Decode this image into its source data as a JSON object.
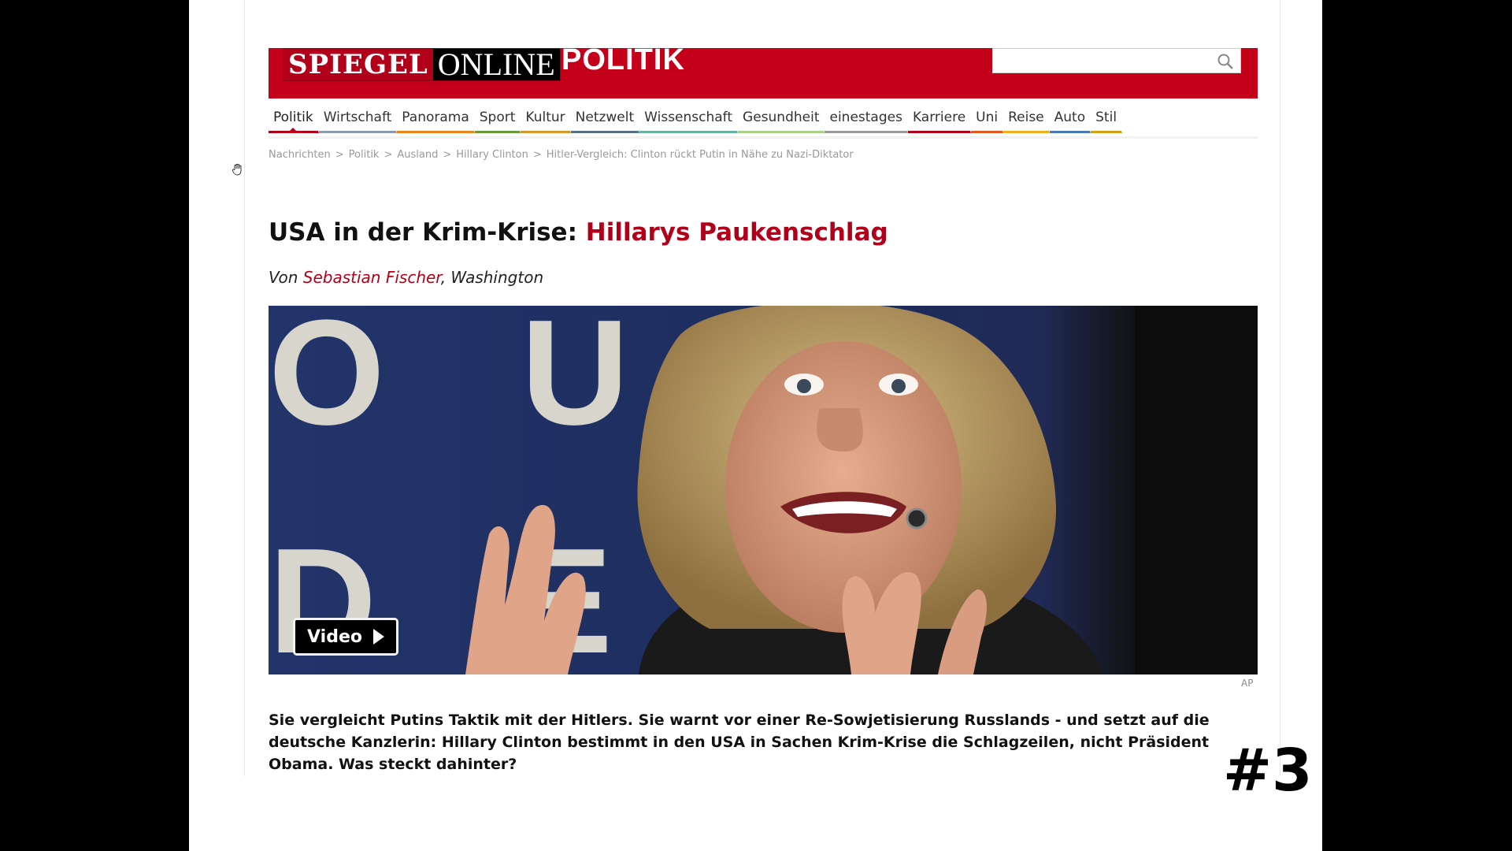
{
  "header": {
    "logo_spiegel": "SPIEGEL",
    "logo_online": "ONLINE",
    "section": "POLITIK",
    "search_placeholder": ""
  },
  "nav": [
    {
      "label": "Politik",
      "color": "#b3001a",
      "active": true
    },
    {
      "label": "Wirtschaft",
      "color": "#8a9bb0"
    },
    {
      "label": "Panorama",
      "color": "#e8851c"
    },
    {
      "label": "Sport",
      "color": "#6a9a3a"
    },
    {
      "label": "Kultur",
      "color": "#d79a2a"
    },
    {
      "label": "Netzwelt",
      "color": "#5a6f8a"
    },
    {
      "label": "Wissenschaft",
      "color": "#6bb2a0"
    },
    {
      "label": "Gesundheit",
      "color": "#a8d08a"
    },
    {
      "label": "einestages",
      "color": "#9a9a9a"
    },
    {
      "label": "Karriere",
      "color": "#b3001a"
    },
    {
      "label": "Uni",
      "color": "#e05a20"
    },
    {
      "label": "Reise",
      "color": "#f0b020"
    },
    {
      "label": "Auto",
      "color": "#4a7ab5"
    },
    {
      "label": "Stil",
      "color": "#d4a017"
    }
  ],
  "breadcrumb": [
    "Nachrichten",
    ">",
    "Politik",
    ">",
    "Ausland",
    ">",
    "Hillary Clinton",
    ">",
    "Hitler-Vergleich: Clinton rückt Putin in Nähe zu Nazi-Diktator"
  ],
  "article": {
    "headline_prefix": "USA in der Krim-Krise: ",
    "headline_main": "Hillarys Paukenschlag",
    "byline_von": "Von ",
    "byline_author": "Sebastian Fischer",
    "byline_place": ", Washington",
    "photo_credit": "AP",
    "video_label": "Video",
    "backdrop_letters_top": "O U C",
    "backdrop_letters_bottom": "D E",
    "intro": "Sie vergleicht Putins Taktik mit der Hitlers. Sie warnt vor einer Re-Sowjetisierung Russlands - und setzt auf die deutsche Kanzlerin: Hillary Clinton bestimmt in den USA in Sachen Krim-Krise die Schlagzeilen, nicht Präsident Obama. Was steckt dahinter?"
  },
  "slide_number": "#3"
}
